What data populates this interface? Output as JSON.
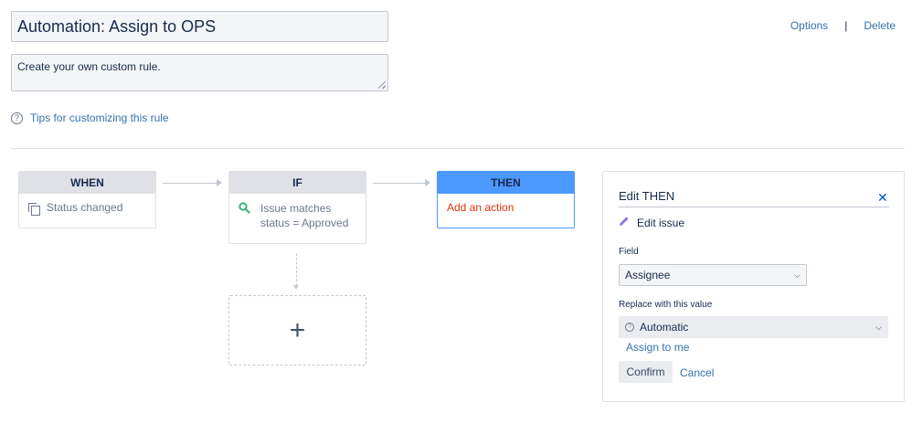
{
  "rule": {
    "title": "Automation: Assign to OPS",
    "description": "Create your own custom rule."
  },
  "header_actions": {
    "options": "Options",
    "separator": "|",
    "delete": "Delete"
  },
  "tips": {
    "icon": "?",
    "label": "Tips for customizing this rule"
  },
  "flow": {
    "when": {
      "heading": "WHEN",
      "text": "Status changed"
    },
    "if": {
      "heading": "IF",
      "line1": "Issue matches",
      "line2": "status = Approved"
    },
    "then": {
      "heading": "THEN",
      "text": "Add an action"
    },
    "add_symbol": "+"
  },
  "panel": {
    "title": "Edit THEN",
    "close_symbol": "✕",
    "action": "Edit issue",
    "field_label": "Field",
    "field_value": "Assignee",
    "replace_label": "Replace with this value",
    "replace_value": "Automatic",
    "assign_to_me": "Assign to me",
    "confirm": "Confirm",
    "cancel": "Cancel"
  },
  "colors": {
    "link": "#3572b0",
    "then_accent": "#4c9aff",
    "action_red": "#de350b",
    "search_green": "#36b37e",
    "pencil_purple": "#8777d9"
  }
}
